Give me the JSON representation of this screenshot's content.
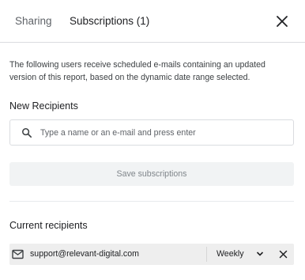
{
  "tabs": [
    {
      "label": "Sharing"
    },
    {
      "label": "Subscriptions (1)"
    }
  ],
  "description": "The following users receive scheduled e-mails containing an updated version of this report, based on the dynamic date range selected.",
  "new_recipients": {
    "heading": "New Recipients",
    "search_placeholder": "Type a name or an e-mail and press enter",
    "search_icon": "search-icon"
  },
  "save_button_label": "Save subscriptions",
  "current_recipients": {
    "heading": "Current recipients",
    "items": [
      {
        "email": "support@relevant-digital.com",
        "frequency": "Weekly",
        "icon": "mail-icon"
      }
    ]
  },
  "colors": {
    "border": "#dadce0",
    "disabled_button_bg": "#f1f3f4",
    "disabled_button_text": "#80868b",
    "recipient_bg": "#eeeeee"
  }
}
